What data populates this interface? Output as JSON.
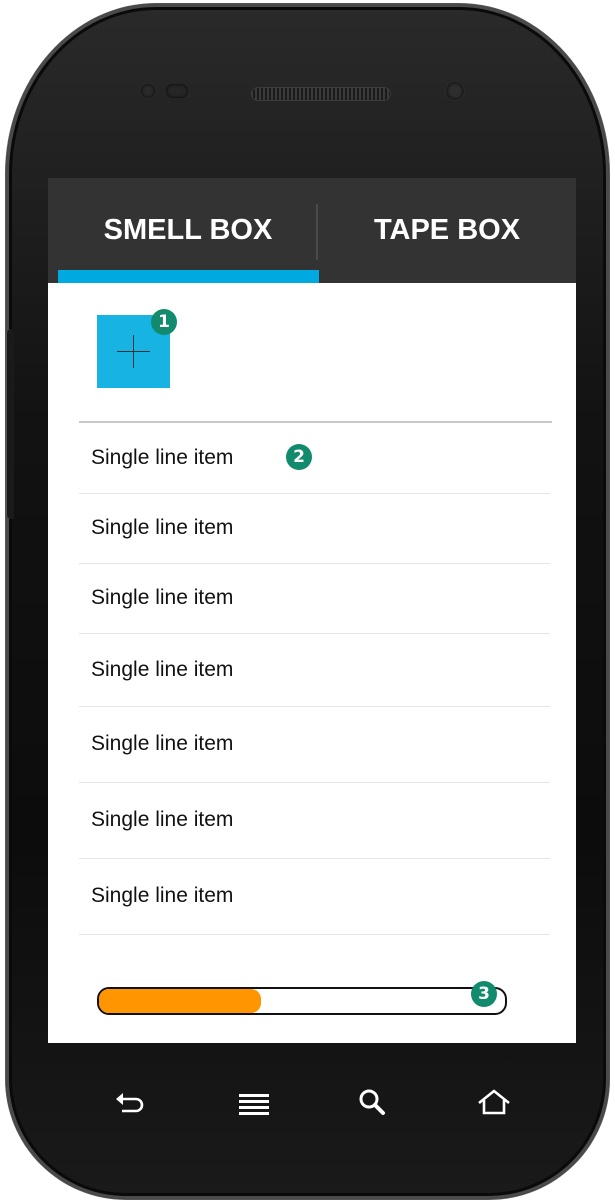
{
  "tabs": [
    {
      "label": "SMELL BOX",
      "selected": true
    },
    {
      "label": "TAPE BOX",
      "selected": false
    }
  ],
  "accent_color": "#00a9e0",
  "add_button": {
    "icon": "plus-icon",
    "color": "#17b3e3"
  },
  "annotations": [
    "1",
    "2",
    "3"
  ],
  "list_items": [
    "Single line item",
    "Single line item",
    "Single line item",
    "Single line item",
    "Single line item",
    "Single line item",
    "Single line item"
  ],
  "progress": {
    "value_percent": 40,
    "fill_color": "#ff9500"
  },
  "nav_bar": [
    "back-icon",
    "menu-icon",
    "search-icon",
    "home-icon"
  ]
}
